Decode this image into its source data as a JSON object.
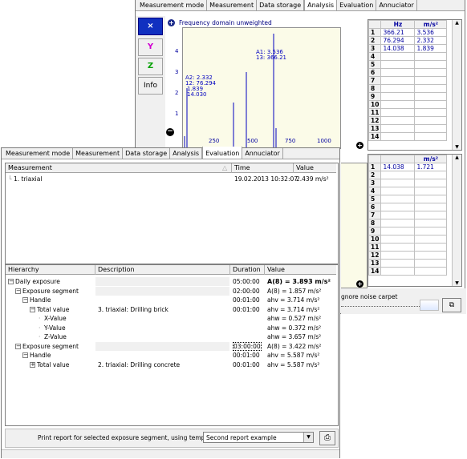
{
  "back_window": {
    "tabs": [
      "Measurement mode",
      "Measurement",
      "Data storage",
      "Analysis",
      "Evaluation",
      "Annuciator"
    ],
    "active_tab": "Analysis",
    "side_buttons": [
      {
        "label": "×",
        "color": "#0000ff"
      },
      {
        "label": "Y",
        "color": "#d000d0"
      },
      {
        "label": "Z",
        "color": "#00a000"
      },
      {
        "label": "Info",
        "color": "#000000"
      }
    ],
    "plot": {
      "title": "Frequency domain unweighted",
      "y_ticks": [
        "4",
        "3",
        "2",
        "1"
      ],
      "x_ticks": [
        "250",
        "500",
        "750",
        "1000"
      ],
      "x_unit": "m/s²",
      "x_label_partial": "Hz",
      "annotation_a1": [
        "A1: 3.536",
        "13: 366.21"
      ],
      "annotation_a2": [
        "A2: 2.332",
        "12: 76.294",
        "1.839",
        "14.030"
      ]
    },
    "grid1": {
      "headers": [
        "Hz",
        "m/s²"
      ],
      "rows": [
        [
          "1",
          "366.21",
          "3.536"
        ],
        [
          "2",
          "76.294",
          "2.332"
        ],
        [
          "3",
          "14.038",
          "1.839"
        ],
        [
          "4",
          "",
          ""
        ],
        [
          "5",
          "",
          ""
        ],
        [
          "6",
          "",
          ""
        ],
        [
          "7",
          "",
          ""
        ],
        [
          "8",
          "",
          ""
        ],
        [
          "9",
          "",
          ""
        ],
        [
          "10",
          "",
          ""
        ],
        [
          "11",
          "",
          ""
        ],
        [
          "12",
          "",
          ""
        ],
        [
          "13",
          "",
          ""
        ],
        [
          "14",
          "",
          ""
        ]
      ]
    },
    "grid2": {
      "headers": [
        "m/s²"
      ],
      "rows": [
        [
          "1",
          "14.038",
          "1.721"
        ],
        [
          "2",
          "",
          ""
        ],
        [
          "3",
          "",
          ""
        ],
        [
          "4",
          "",
          ""
        ],
        [
          "5",
          "",
          ""
        ],
        [
          "6",
          "",
          ""
        ],
        [
          "7",
          "",
          ""
        ],
        [
          "8",
          "",
          ""
        ],
        [
          "9",
          "",
          ""
        ],
        [
          "10",
          "",
          ""
        ],
        [
          "11",
          "",
          ""
        ],
        [
          "12",
          "",
          ""
        ],
        [
          "13",
          "",
          ""
        ],
        [
          "14",
          "",
          ""
        ]
      ]
    },
    "ignore_noise_label": "gnore noise carpet"
  },
  "front_window": {
    "tabs": [
      "Measurement mode",
      "Measurement",
      "Data storage",
      "Analysis",
      "Evaluation",
      "Annuciator"
    ],
    "active_tab": "Evaluation",
    "measurement_table": {
      "headers": [
        "Measurement",
        "Time",
        "Value"
      ],
      "rows": [
        {
          "name": "1. triaxial",
          "time": "19.02.2013 10:32:07",
          "value": "2.439 m/s²"
        }
      ]
    },
    "hierarchy_table": {
      "headers": [
        "Hierarchy",
        "Description",
        "Duration",
        "Value"
      ],
      "rows": [
        {
          "indent": 0,
          "toggle": "−",
          "name": "Daily exposure",
          "desc": "",
          "duration": "05:00:00",
          "value": "A(8) = 3.893 m/s²",
          "bold": true
        },
        {
          "indent": 1,
          "toggle": "−",
          "name": "Exposure segment",
          "desc": "",
          "duration": "02:00:00",
          "value": "A(8) = 1.857 m/s²",
          "bold": false
        },
        {
          "indent": 2,
          "toggle": "−",
          "name": "Handle",
          "desc": "",
          "duration": "00:01:00",
          "value": "ahv = 3.714 m/s²",
          "bold": false
        },
        {
          "indent": 3,
          "toggle": "−",
          "name": "Total value",
          "desc": "3. triaxial: Drilling brick",
          "duration": "00:01:00",
          "value": "ahv = 3.714 m/s²",
          "bold": false
        },
        {
          "indent": 4,
          "toggle": "",
          "name": "X-Value",
          "desc": "",
          "duration": "",
          "value": "ahw = 0.527 m/s²",
          "bold": false
        },
        {
          "indent": 4,
          "toggle": "",
          "name": "Y-Value",
          "desc": "",
          "duration": "",
          "value": "ahw = 0.372 m/s²",
          "bold": false
        },
        {
          "indent": 4,
          "toggle": "",
          "name": "Z-Value",
          "desc": "",
          "duration": "",
          "value": "ahw = 3.657 m/s²",
          "bold": false
        },
        {
          "indent": 1,
          "toggle": "−",
          "name": "Exposure segment",
          "desc": "",
          "duration": "03:00:00",
          "value": "A(8) = 3.422 m/s²",
          "bold": false
        },
        {
          "indent": 2,
          "toggle": "−",
          "name": "Handle",
          "desc": "",
          "duration": "00:01:00",
          "value": "ahv = 5.587 m/s²",
          "bold": false
        },
        {
          "indent": 3,
          "toggle": "+",
          "name": "Total value",
          "desc": "2. triaxial: Drilling concrete",
          "duration": "00:01:00",
          "value": "ahv = 5.587 m/s²",
          "bold": false
        }
      ]
    },
    "footer": {
      "print_label": "Print report for selected exposure segment, using template:",
      "template_value": "Second report example"
    }
  }
}
